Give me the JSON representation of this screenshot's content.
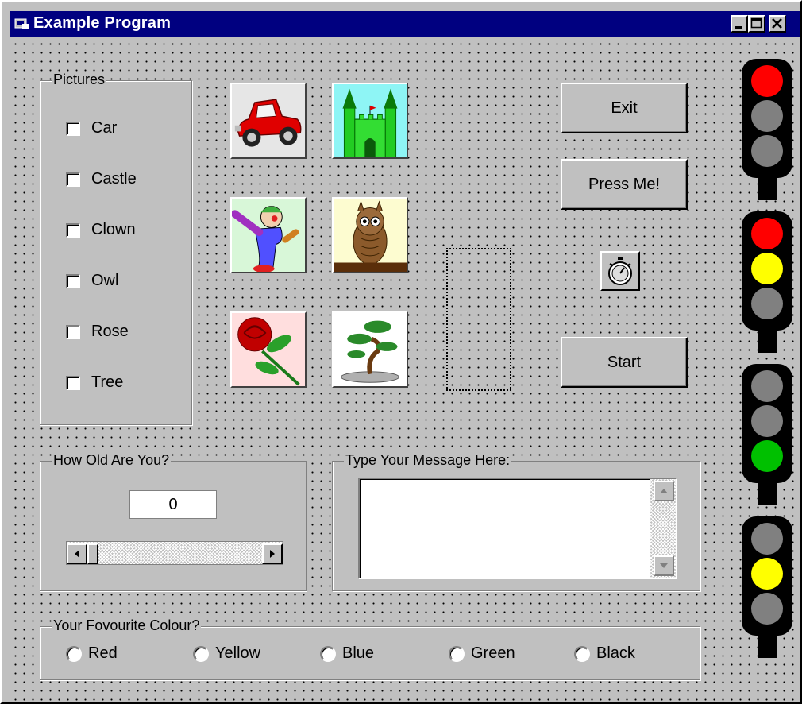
{
  "window": {
    "title": "Example Program"
  },
  "pictures_frame": {
    "label": "Pictures",
    "items": [
      {
        "label": "Car"
      },
      {
        "label": "Castle"
      },
      {
        "label": "Clown"
      },
      {
        "label": "Owl"
      },
      {
        "label": "Rose"
      },
      {
        "label": "Tree"
      }
    ]
  },
  "buttons": {
    "exit": "Exit",
    "press": "Press Me!",
    "start": "Start"
  },
  "age_frame": {
    "label": "How Old Are You?",
    "value": "0"
  },
  "message_frame": {
    "label": "Type Your Message Here:",
    "text": ""
  },
  "colour_frame": {
    "label": "Your Fovourite Colour?",
    "options": [
      "Red",
      "Yellow",
      "Blue",
      "Green",
      "Black"
    ]
  },
  "traffic_lights": [
    {
      "lit": [
        "red",
        "off",
        "off"
      ]
    },
    {
      "lit": [
        "red",
        "yellow",
        "off"
      ]
    },
    {
      "lit": [
        "off",
        "off",
        "green"
      ]
    },
    {
      "lit": [
        "off",
        "yellow",
        "off"
      ]
    }
  ],
  "colors": {
    "titlebar": "#000080",
    "face": "#c0c0c0",
    "red": "#ff0000",
    "yellow": "#ffff00",
    "green": "#00c000",
    "off": "#808080"
  },
  "icons": {
    "app": "app-icon",
    "minimize": "minimize-icon",
    "maximize": "maximize-icon",
    "close": "close-icon",
    "timer": "stopwatch-icon"
  }
}
